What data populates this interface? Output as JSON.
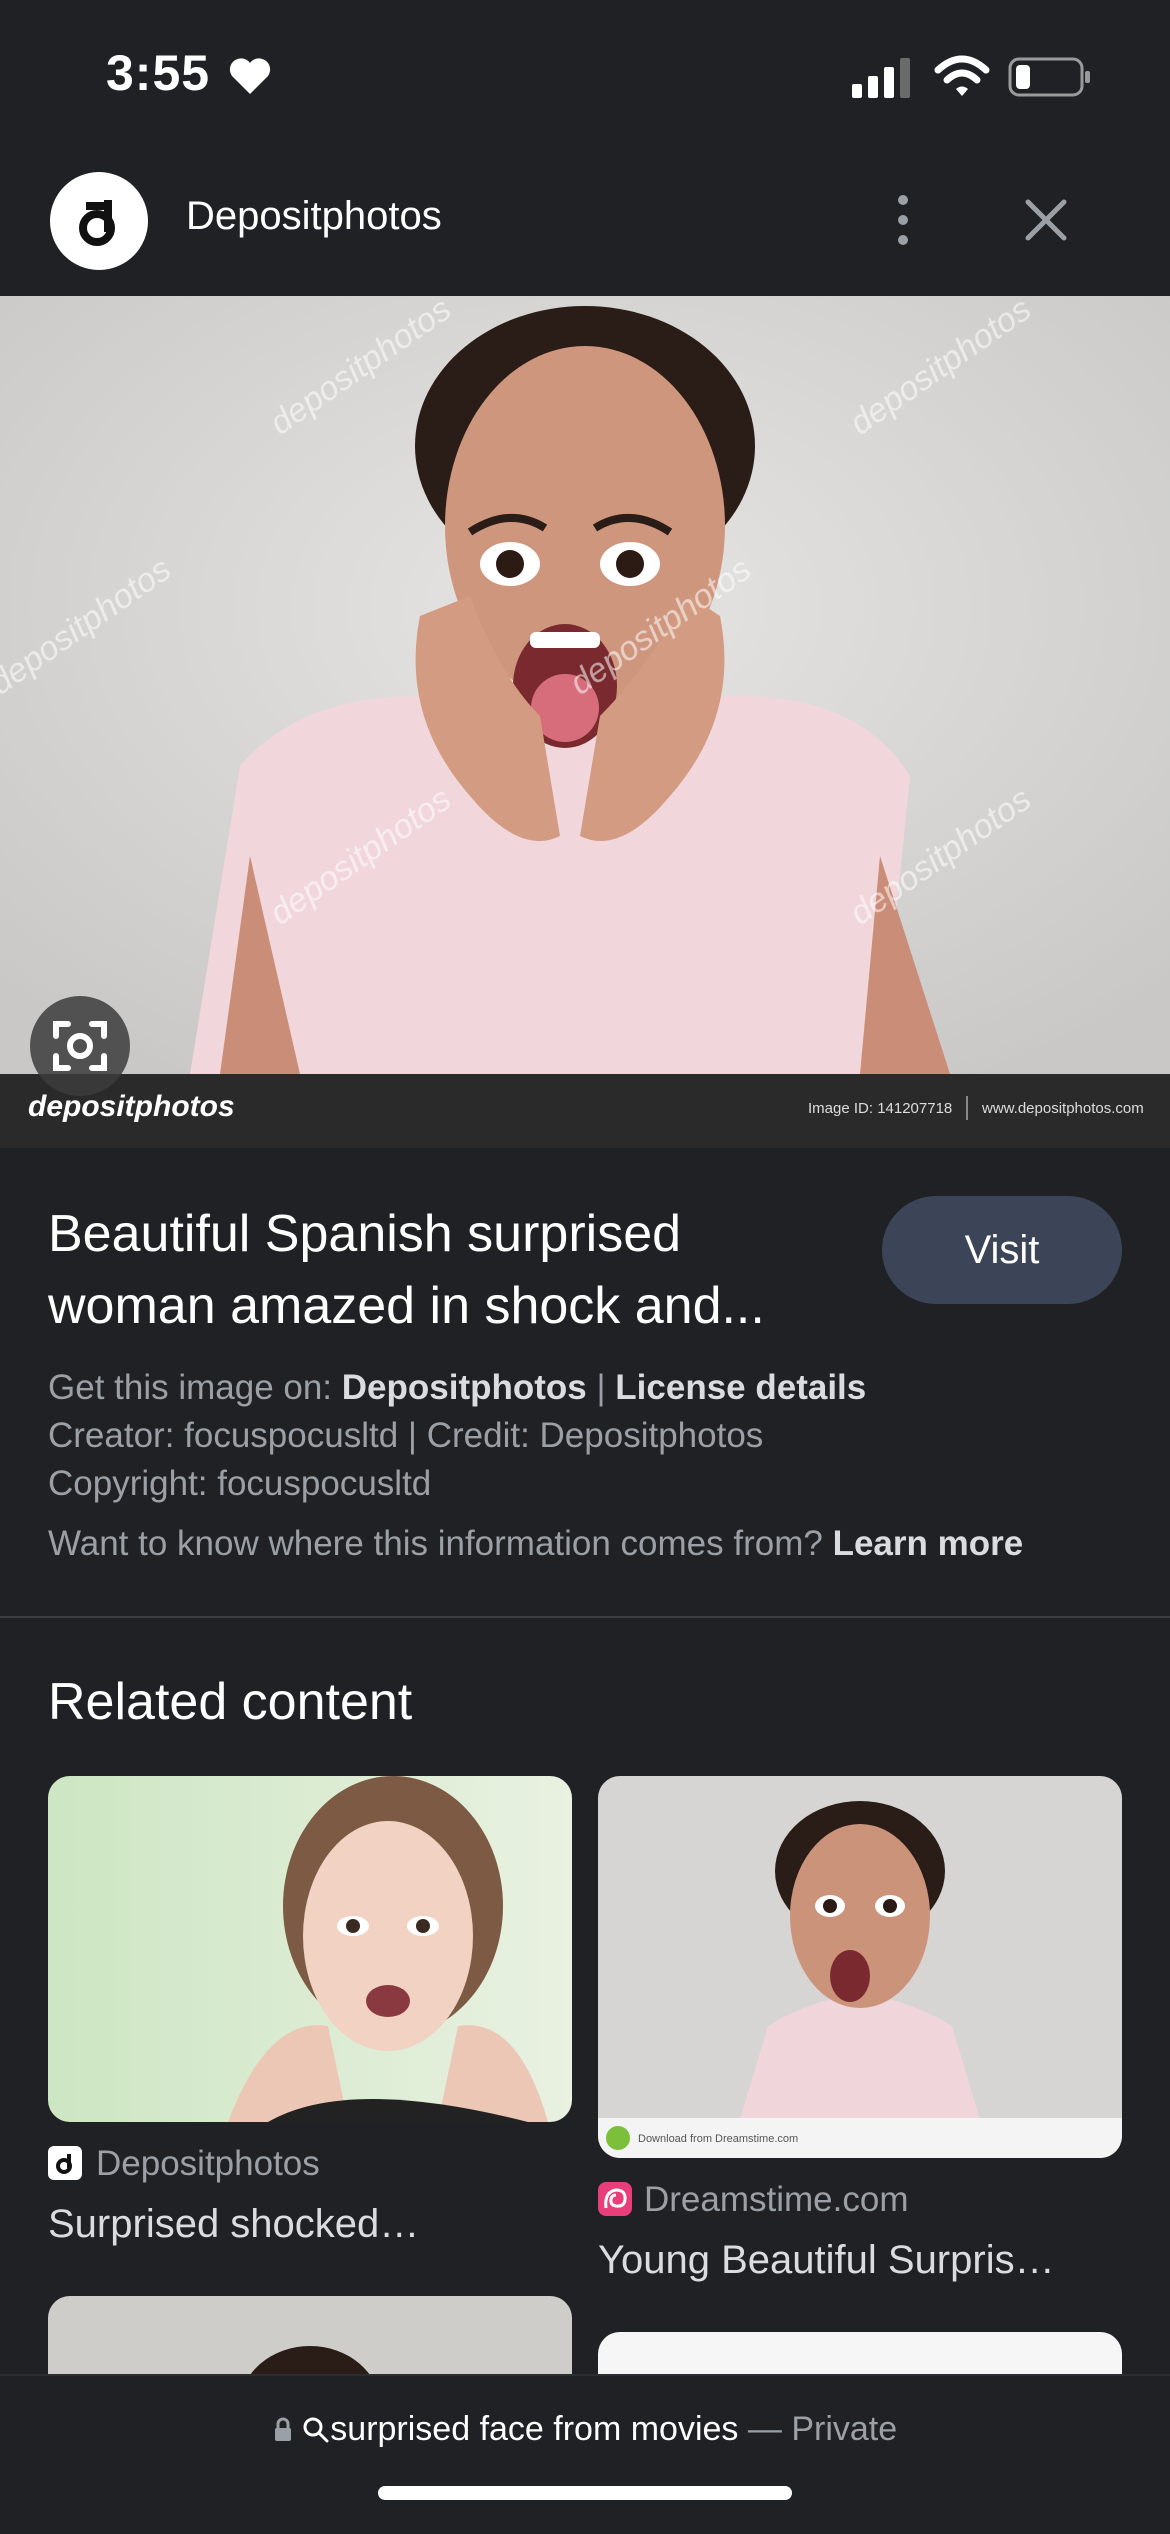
{
  "status": {
    "time": "3:55"
  },
  "header": {
    "site_name": "Depositphotos"
  },
  "hero": {
    "watermark_brand": "depositphotos",
    "image_id": "Image ID: 141207718",
    "site_url": "www.depositphotos.com",
    "watermark_text": "depositphotos"
  },
  "details": {
    "title": "Beautiful Spanish surprised woman amazed in shock and...",
    "visit_label": "Visit",
    "get_image_prefix": "Get this image on: ",
    "get_image_source": "Depositphotos",
    "separator": " | ",
    "license_label": "License details",
    "creator_line": "Creator: focuspocusltd | Credit: Depositphotos",
    "copyright_line": "Copyright: focuspocusltd",
    "info_question": "Want to know where this information comes from? ",
    "learn_more": "Learn more"
  },
  "related": {
    "title": "Related content",
    "cards": [
      {
        "source": "Depositphotos",
        "caption": "Surprised shocked…"
      },
      {
        "source": "Dreamstime.com",
        "caption": "Young Beautiful Surpris…"
      }
    ],
    "dreamstime_strip": "Download from Dreamstime.com"
  },
  "bottom": {
    "query": "surprised face from movies",
    "dash": " — ",
    "private": "Private"
  },
  "colors": {
    "background": "#202124",
    "visit_button": "#3c4557",
    "dreamstime": "#e83f7a"
  }
}
